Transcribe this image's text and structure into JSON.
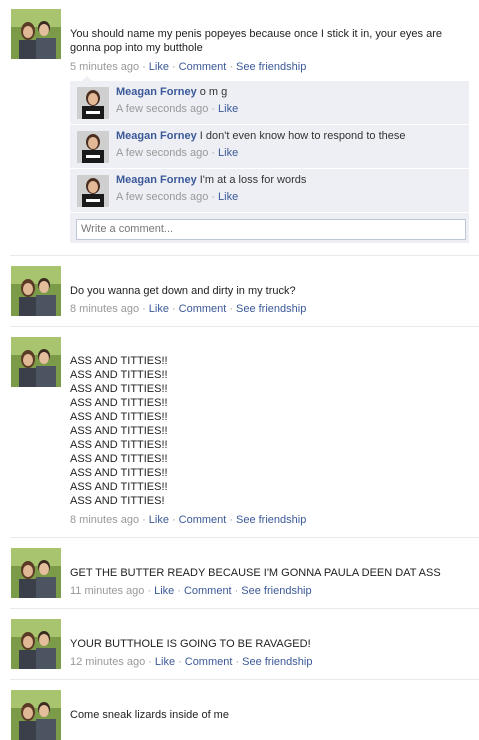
{
  "colors": {
    "link": "#3b5998",
    "meta": "#999999",
    "comment_bg": "#edeff4"
  },
  "icons": {
    "avatar": "profile-photo-couple",
    "commenter": "profile-photo-meagan"
  },
  "actions": {
    "like": "Like",
    "comment": "Comment",
    "friendship": "See friendship"
  },
  "stories": [
    {
      "text": "You should name my penis popeyes because once I stick it in, your eyes are gonna pop into my butthole",
      "time": "5 minutes ago"
    },
    {
      "text": "Do you wanna get down and dirty in my truck?",
      "time": "8 minutes ago"
    },
    {
      "lines": [
        "ASS AND TITTIES!!",
        "ASS AND TITTIES!!",
        "ASS AND TITTIES!!",
        "ASS AND TITTIES!!",
        "ASS AND TITTIES!!",
        "ASS AND TITTIES!!",
        "ASS AND TITTIES!!",
        "ASS AND TITTIES!!",
        "ASS AND TITTIES!!",
        "ASS AND TITTIES!!",
        "ASS AND TITTIES!"
      ],
      "time": "8 minutes ago"
    },
    {
      "text": "GET THE BUTTER READY BECAUSE I'M GONNA PAULA DEEN DAT ASS",
      "time": "11 minutes ago"
    },
    {
      "text": "YOUR BUTTHOLE IS GOING TO BE RAVAGED!",
      "time": "12 minutes ago"
    },
    {
      "text": "Come sneak lizards inside of me"
    }
  ],
  "comments": [
    {
      "name": "Meagan Forney",
      "text": "o m g",
      "time": "A few seconds ago",
      "like": "Like"
    },
    {
      "name": "Meagan Forney",
      "text": "I don't even know how to respond to these",
      "time": "A few seconds ago",
      "like": "Like"
    },
    {
      "name": "Meagan Forney",
      "text": "I'm at a loss for words",
      "time": "A few seconds ago",
      "like": "Like"
    }
  ],
  "comment_input": {
    "placeholder": "Write a comment..."
  }
}
